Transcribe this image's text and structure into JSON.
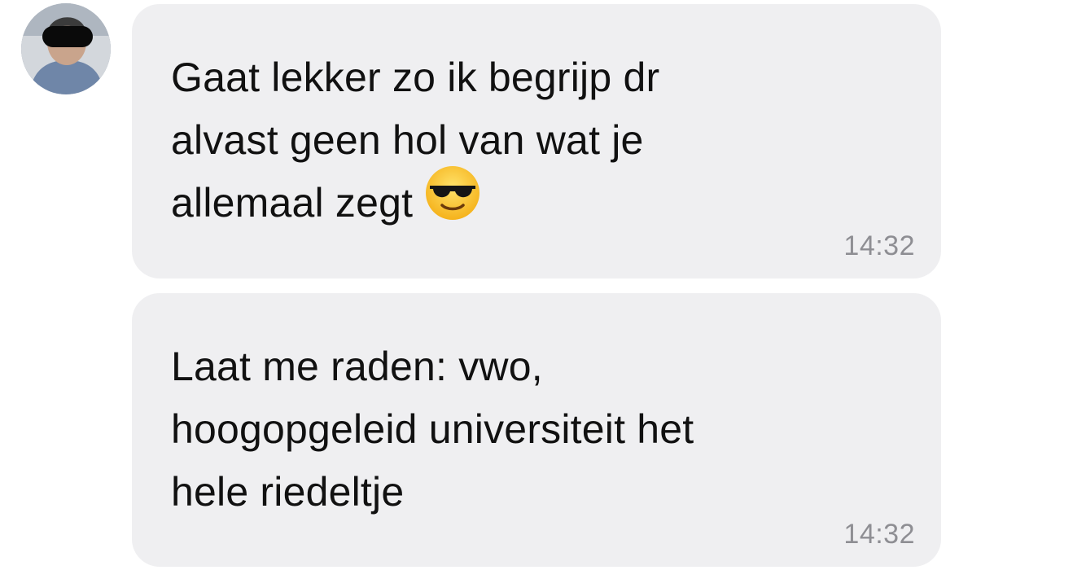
{
  "chat": {
    "contact": {
      "avatar_icon": "contact-avatar-photo"
    },
    "messages": [
      {
        "lines": [
          "Gaat lekker zo ik begrijp dr",
          "alvast geen hol van wat je",
          "allemaal zegt"
        ],
        "emoji_icon": "smiling-face-with-sunglasses",
        "time": "14:32"
      },
      {
        "lines": [
          "Laat me raden: vwo,",
          "hoogopgeleid universiteit het",
          "hele riedeltje"
        ],
        "time": "14:32"
      }
    ],
    "colors": {
      "bubble_background": "#efeff1",
      "text": "#111111",
      "timestamp": "#8e8e93"
    }
  }
}
